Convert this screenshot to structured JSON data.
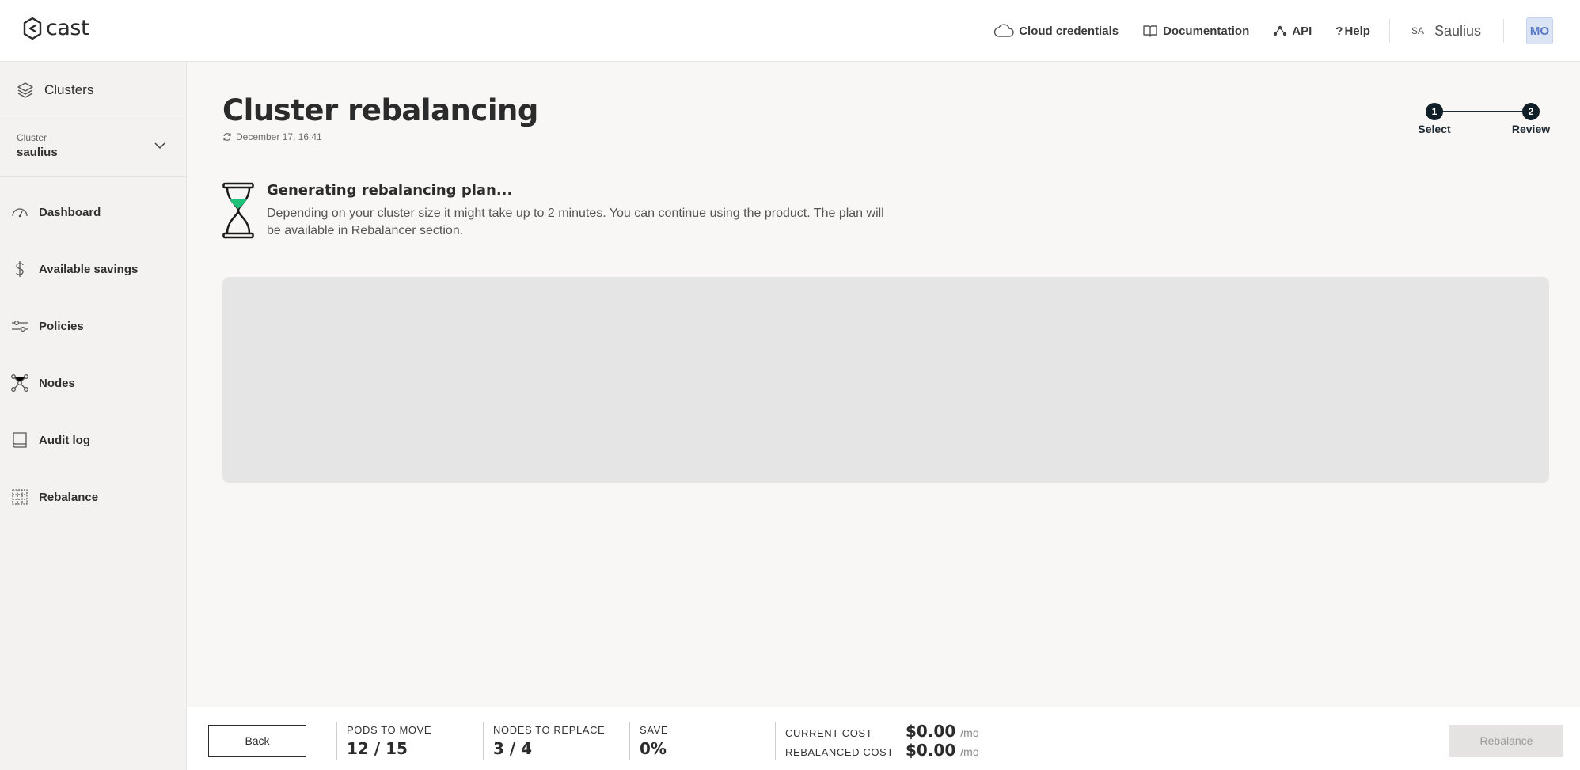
{
  "brand": {
    "name": "cast"
  },
  "header": {
    "nav": [
      {
        "label": "Cloud credentials",
        "icon": "cloud-icon"
      },
      {
        "label": "Documentation",
        "icon": "book-open-icon"
      },
      {
        "label": "API",
        "icon": "api-icon"
      },
      {
        "label": "Help",
        "icon": "question-icon"
      }
    ],
    "user": {
      "initials": "SA",
      "name": "Saulius"
    },
    "org_badge": "MO"
  },
  "sidebar": {
    "clusters_label": "Clusters",
    "cluster_select": {
      "label": "Cluster",
      "value": "saulius"
    },
    "items": [
      {
        "label": "Dashboard",
        "icon": "gauge-icon"
      },
      {
        "label": "Available savings",
        "icon": "dollar-icon"
      },
      {
        "label": "Policies",
        "icon": "sliders-icon"
      },
      {
        "label": "Nodes",
        "icon": "nodes-icon"
      },
      {
        "label": "Audit log",
        "icon": "book-icon"
      },
      {
        "label": "Rebalance",
        "icon": "grid-icon"
      }
    ]
  },
  "main": {
    "title": "Cluster rebalancing",
    "timestamp": "December 17, 16:41",
    "steps": [
      {
        "number": "1",
        "label": "Select"
      },
      {
        "number": "2",
        "label": "Review"
      }
    ],
    "status": {
      "title": "Generating rebalancing plan...",
      "description": "Depending on your cluster size it might take up to 2 minutes. You can continue using the product. The plan will be available in Rebalancer section."
    }
  },
  "footer": {
    "back_label": "Back",
    "pods_to_move": {
      "label": "PODS TO MOVE",
      "value": "12 / 15"
    },
    "nodes_to_replace": {
      "label": "NODES TO REPLACE",
      "value": "3 / 4"
    },
    "save": {
      "label": "SAVE",
      "value": "0%"
    },
    "current_cost": {
      "label": "CURRENT COST",
      "value": "$0.00",
      "unit": "/mo"
    },
    "rebalanced_cost": {
      "label": "REBALANCED COST",
      "value": "$0.00",
      "unit": "/mo"
    },
    "rebalance_label": "Rebalance"
  },
  "colors": {
    "accent_dark": "#0f1e27",
    "hourglass_sand": "#1fc27a",
    "org_badge": "#dbe4f5"
  }
}
